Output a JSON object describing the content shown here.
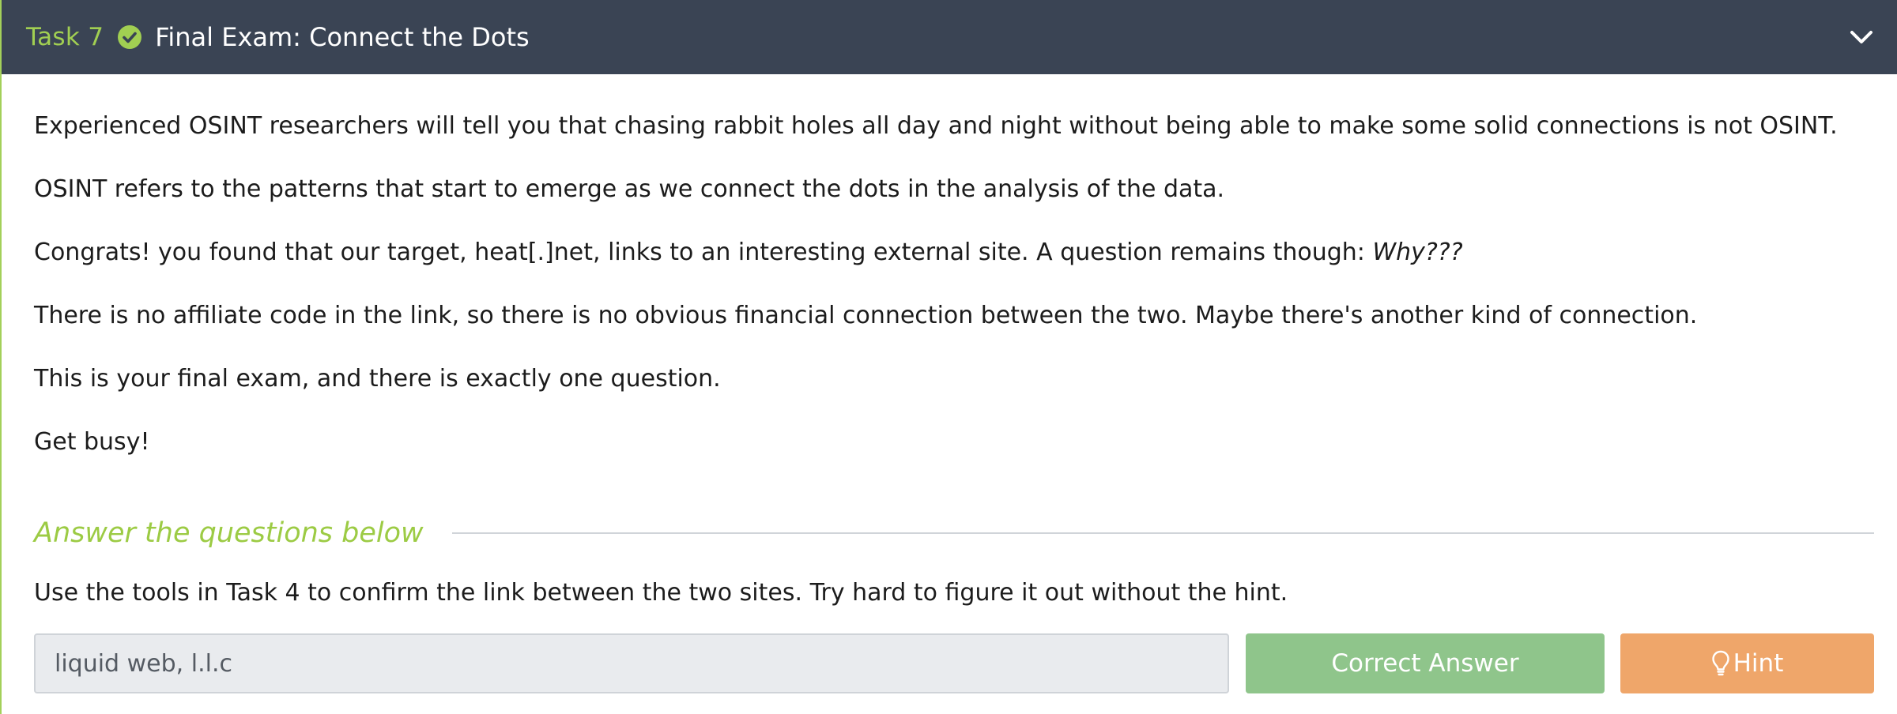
{
  "colors": {
    "header_bg": "#3a4454",
    "task_number": "#a1cf52",
    "accent_green": "#9ccb44",
    "correct_button": "#8fc58b",
    "hint_button": "#efa66a",
    "input_bg": "#e9ebee"
  },
  "task": {
    "number_label": "Task 7",
    "status_icon": "check-circle-icon",
    "title": "Final Exam: Connect the Dots",
    "toggle_icon": "chevron-down-icon"
  },
  "content": {
    "p1": "Experienced OSINT researchers will tell you that chasing rabbit holes all day and night without being able to make some solid connections is not OSINT.",
    "p2": "OSINT refers to the patterns that start to emerge as we connect the dots in the analysis of the data.",
    "p3_text": "Congrats! you found that our target, heat[.]net, links to an interesting external site. A question remains though: ",
    "p3_emphasis": "Why???",
    "p4": "There is no affiliate code in the link, so there is no obvious financial connection between the two. Maybe there's another kind of connection.",
    "p5": "This is your final exam, and there is exactly one question.",
    "p6": "Get busy!"
  },
  "answers": {
    "heading": "Answer the questions below",
    "question": "Use the tools in Task 4 to confirm the link between the two sites. Try hard to figure it out without the hint.",
    "answer_value": "liquid web, l.l.c",
    "correct_label": "Correct Answer",
    "hint_icon": "lightbulb-icon",
    "hint_label": "Hint"
  }
}
